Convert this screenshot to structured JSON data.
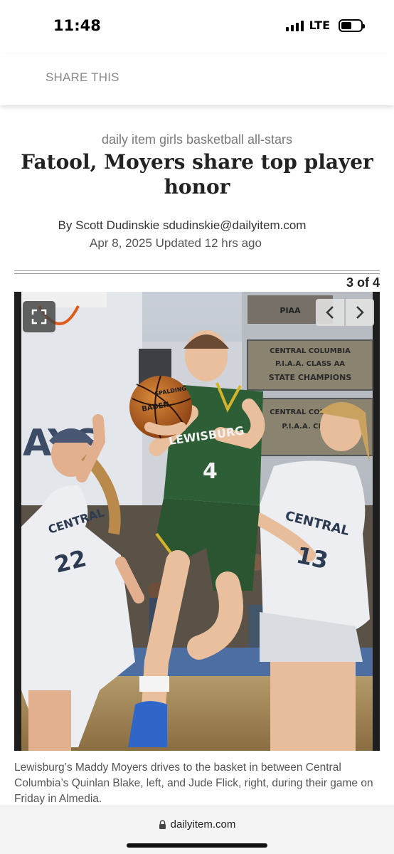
{
  "status_bar": {
    "time": "11:48",
    "network": "LTE",
    "icons": [
      "signal-icon",
      "battery-icon"
    ]
  },
  "share_bar": {
    "label": "SHARE THIS"
  },
  "article": {
    "kicker": "daily item girls basketball all-stars",
    "headline": "Fatool, Moyers share top player honor",
    "byline": "By Scott Dudinskie sdudinskie@dailyitem.com",
    "dateline": "Apr 8, 2025 Updated 12 hrs ago"
  },
  "gallery": {
    "counter": "3 of 4",
    "controls": [
      "expand-icon",
      "chevron-left-icon",
      "chevron-right-icon"
    ],
    "photo_text": {
      "jersey_center": "LEWISBURG",
      "jersey_center_number": "4",
      "jersey_left": "CENTRAL",
      "jersey_left_number": "22",
      "jersey_right": "CENTRAL",
      "jersey_right_number": "13",
      "ball_brand": "BADEN",
      "ball_logo": "SPALDING",
      "banner_1": "CENTRAL COLUMBIA",
      "banner_2": "P.I.A.A. CLASS AA",
      "banner_3": "STATE CHAMPIONS",
      "banner_4": "CENTRAL COLUMBIA",
      "banner_5": "P.I.A.A. CLASS",
      "wall_letters": "AYS",
      "sign_top": "PIAA"
    },
    "caption": "Lewisburg’s Maddy Moyers drives to the basket in between Central Columbia’s Quinlan Blake, left, and Jude Flick, right, during their game on Friday in Almedia."
  },
  "browser": {
    "url": "dailyitem.com",
    "icons": [
      "lock-icon"
    ]
  },
  "colors": {
    "lewisburg_green": "#2e5e35",
    "lewisburg_gold": "#d4b52a",
    "central_white": "#ecedf0",
    "central_navy": "#2c3a52"
  }
}
